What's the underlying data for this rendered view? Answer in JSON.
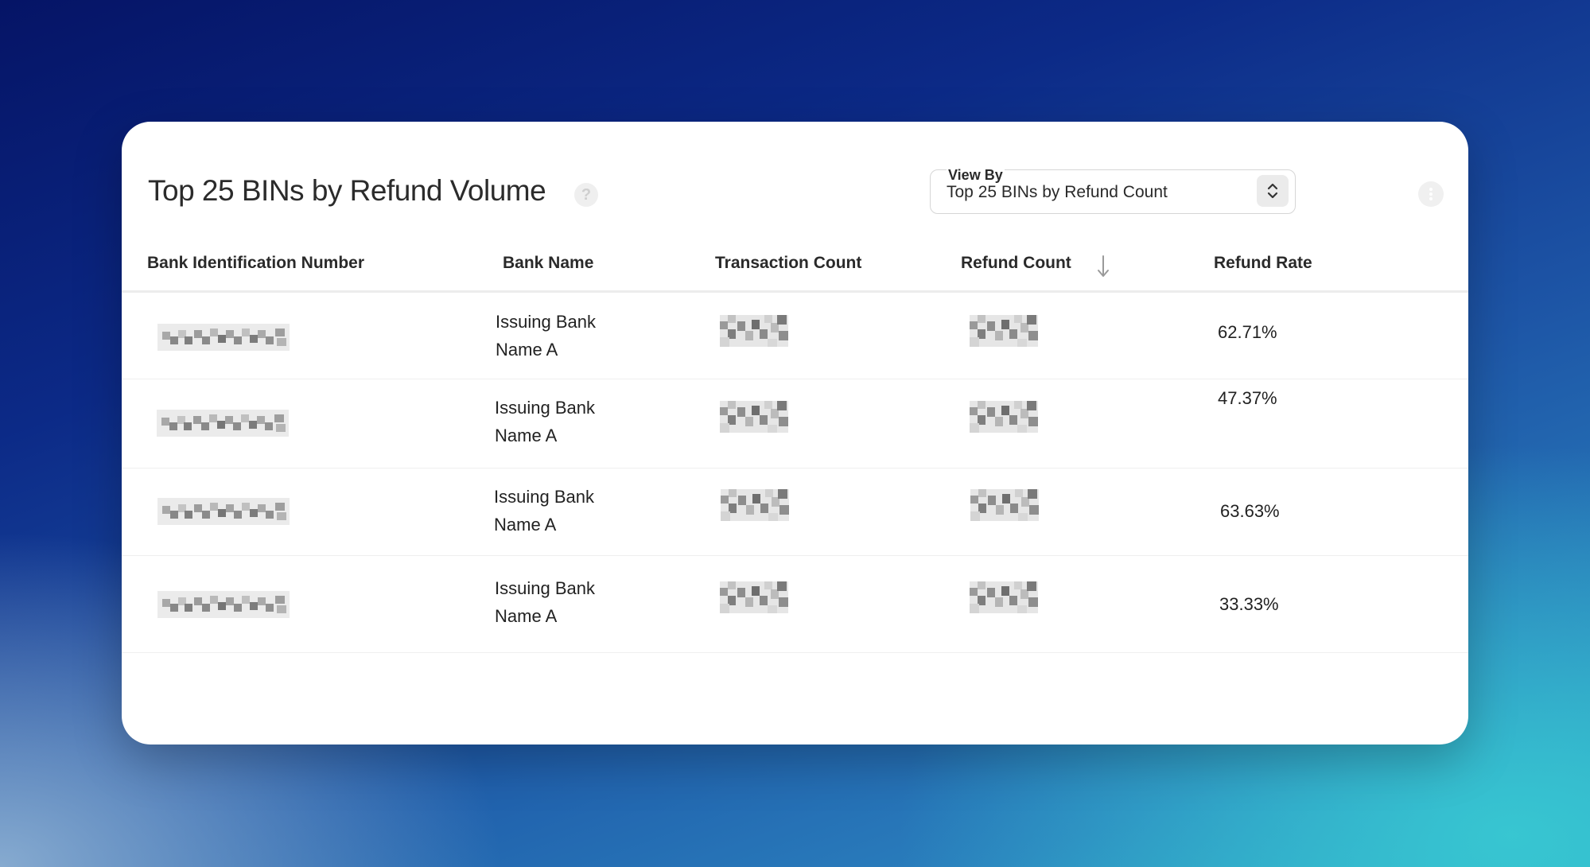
{
  "panel": {
    "title": "Top 25 BINs by Refund Volume",
    "view_by": {
      "label": "View By",
      "value": "Top 25 BINs by Refund Count"
    }
  },
  "table": {
    "columns": [
      "Bank Identification Number",
      "Bank Name",
      "Transaction Count",
      "Refund Count",
      "Refund Rate"
    ],
    "sorted_column": "Refund Count",
    "sort_direction": "descending",
    "rows": [
      {
        "bank_name_line1": "Issuing Bank",
        "bank_name_line2": "Name A",
        "refund_rate": "62.71%"
      },
      {
        "bank_name_line1": "Issuing Bank",
        "bank_name_line2": "Name A",
        "refund_rate": "47.37%"
      },
      {
        "bank_name_line1": "Issuing Bank",
        "bank_name_line2": "Name A",
        "refund_rate": "63.63%"
      },
      {
        "bank_name_line1": "Issuing Bank",
        "bank_name_line2": "Name A",
        "refund_rate": "33.33%"
      }
    ]
  },
  "icons": {
    "help": "question-circle-icon",
    "stepper": "chevron-up-down-icon",
    "sort": "arrow-down-icon",
    "more": "vertical-ellipsis-icon"
  }
}
